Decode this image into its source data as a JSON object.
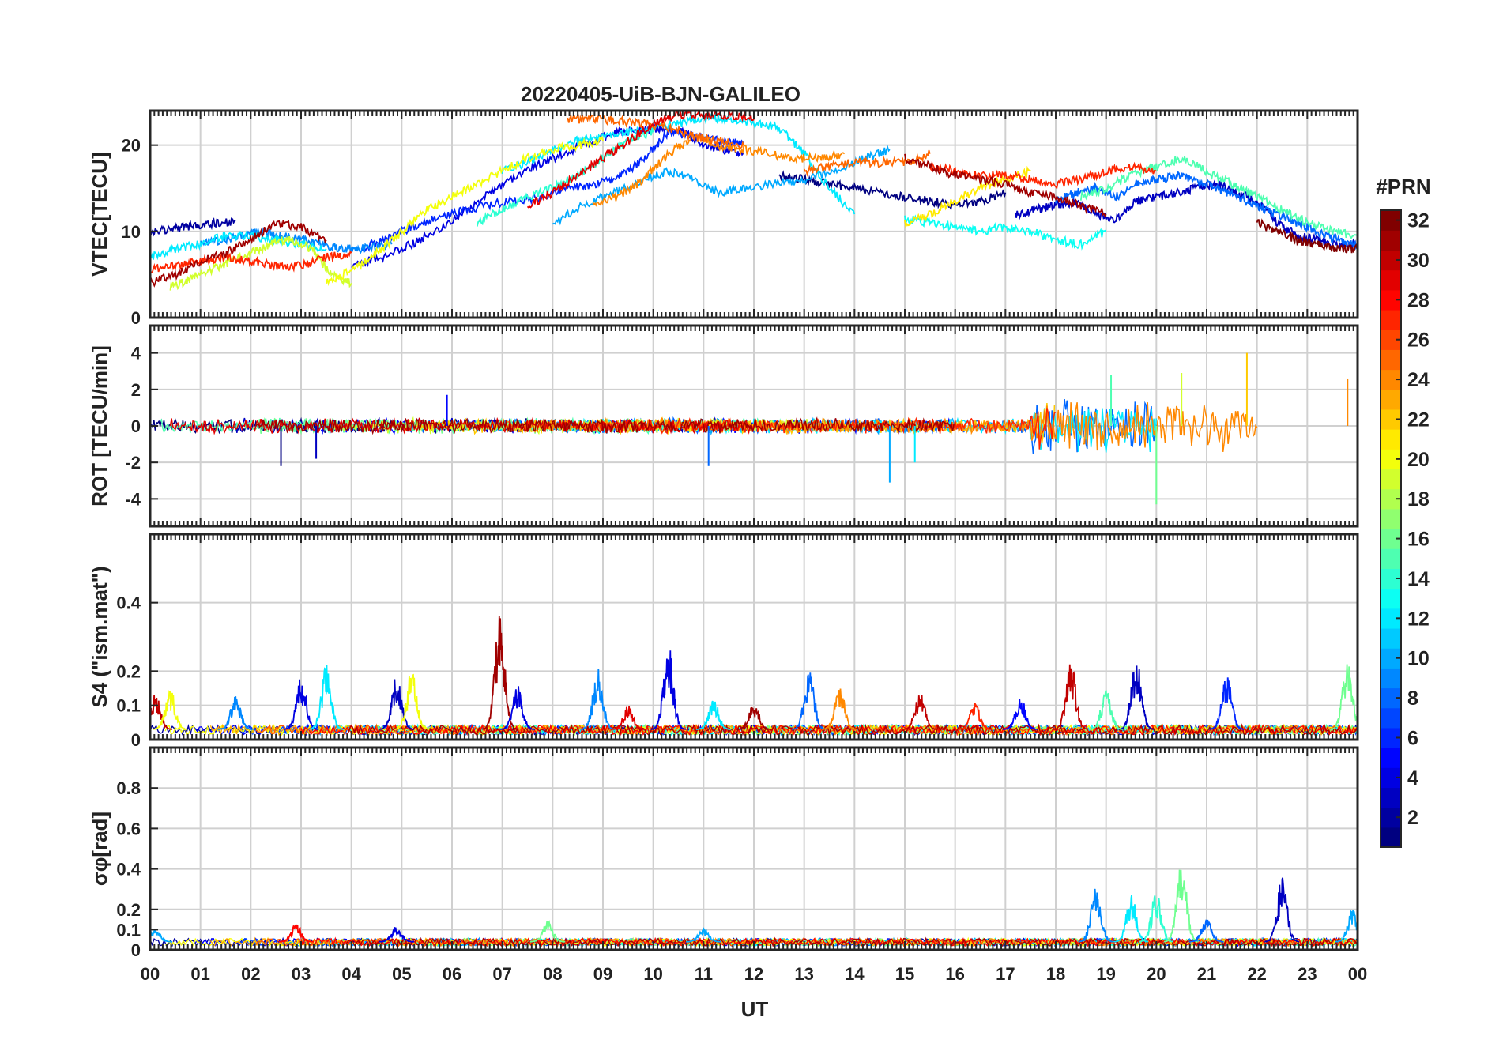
{
  "chart_data": {
    "type": "line",
    "title": "20220405-UiB-BJN-GALILEO",
    "xlabel": "UT",
    "x_tick_labels": [
      "00",
      "01",
      "02",
      "03",
      "04",
      "05",
      "06",
      "07",
      "08",
      "09",
      "10",
      "11",
      "12",
      "13",
      "14",
      "15",
      "16",
      "17",
      "18",
      "19",
      "20",
      "21",
      "22",
      "23",
      "00"
    ],
    "xlim": [
      0,
      24
    ],
    "grid": true,
    "colorbar": {
      "label": "#PRN",
      "colormap": "jet",
      "range": [
        1,
        32
      ],
      "tick_labels": [
        "2",
        "4",
        "6",
        "8",
        "10",
        "12",
        "14",
        "16",
        "18",
        "20",
        "22",
        "24",
        "26",
        "28",
        "30",
        "32"
      ]
    },
    "panels": [
      {
        "id": "vtec",
        "ylabel": "VTEC[TECU]",
        "ylim": [
          0,
          24
        ],
        "yticks": [
          0,
          10,
          20
        ],
        "series": [
          {
            "prn": 2,
            "x": [
              0.0,
              0.4,
              0.8,
              1.2,
              1.7
            ],
            "y": [
              10.0,
              10.2,
              10.6,
              10.9,
              11.2
            ]
          },
          {
            "prn": 4,
            "x": [
              4.0,
              4.6,
              5.2,
              5.8,
              6.4,
              7.0,
              7.6,
              8.2,
              8.8,
              9.3,
              9.8,
              10.2,
              10.6,
              11.0,
              11.4,
              11.8
            ],
            "y": [
              6.0,
              7.0,
              8.5,
              10.5,
              13.0,
              15.5,
              17.5,
              19.0,
              20.5,
              21.5,
              21.8,
              22.0,
              21.5,
              20.0,
              19.5,
              19.0
            ]
          },
          {
            "prn": 6,
            "x": [
              4.2,
              4.8,
              5.4,
              6.0,
              6.6,
              7.2,
              7.8,
              8.4,
              8.9,
              9.4,
              9.9,
              10.3,
              10.8,
              11.3,
              11.8
            ],
            "y": [
              8.0,
              9.5,
              11.0,
              12.0,
              13.0,
              13.5,
              14.0,
              15.0,
              15.5,
              16.5,
              19.0,
              21.5,
              21.0,
              20.5,
              20.2
            ]
          },
          {
            "prn": 1,
            "x": [
              12.5,
              13.0,
              13.5,
              14.0,
              14.5,
              15.0,
              15.5,
              16.0,
              16.5,
              17.0
            ],
            "y": [
              16.5,
              16.0,
              15.5,
              15.0,
              14.5,
              14.0,
              13.5,
              13.0,
              13.5,
              14.5
            ]
          },
          {
            "prn": 3,
            "x": [
              17.2,
              17.6,
              18.0,
              18.4,
              18.8,
              19.2,
              19.6,
              20.0,
              20.4,
              20.8,
              21.2,
              21.6,
              22.0,
              22.4,
              22.8,
              23.2,
              23.6,
              24.0
            ],
            "y": [
              12.0,
              12.5,
              13.0,
              13.5,
              12.0,
              11.5,
              13.5,
              14.0,
              14.5,
              15.0,
              15.5,
              14.5,
              13.5,
              11.0,
              9.5,
              9.0,
              8.5,
              8.5
            ]
          },
          {
            "prn": 9,
            "x": [
              1.0,
              1.4,
              1.8,
              2.2,
              2.6,
              3.0,
              3.4,
              3.8,
              4.2,
              4.8
            ],
            "y": [
              8.5,
              9.0,
              9.5,
              10.0,
              9.5,
              9.0,
              8.5,
              8.0,
              8.0,
              8.5
            ]
          },
          {
            "prn": 10,
            "x": [
              8.0,
              8.6,
              9.2,
              9.8,
              10.3,
              10.8,
              11.3,
              11.8,
              12.4,
              13.0,
              13.6,
              14.2,
              14.7
            ],
            "y": [
              11.0,
              13.0,
              14.5,
              16.0,
              17.0,
              16.0,
              14.5,
              15.0,
              15.5,
              16.0,
              17.0,
              18.5,
              19.5
            ]
          },
          {
            "prn": 8,
            "x": [
              18.0,
              18.4,
              18.8,
              19.2,
              19.6,
              20.0,
              20.4,
              20.8,
              21.2,
              21.6,
              22.0,
              22.4,
              22.8,
              23.2,
              23.6,
              24.0
            ],
            "y": [
              13.5,
              14.5,
              15.0,
              14.0,
              15.5,
              16.0,
              16.5,
              16.0,
              15.0,
              14.0,
              13.0,
              12.0,
              11.0,
              10.0,
              9.0,
              8.5
            ]
          },
          {
            "prn": 12,
            "x": [
              0.0,
              0.5,
              1.0,
              1.5,
              2.0,
              2.5,
              3.0,
              3.5
            ],
            "y": [
              7.0,
              8.0,
              8.5,
              9.5,
              9.5,
              9.0,
              8.5,
              8.0
            ]
          },
          {
            "prn": 12,
            "x": [
              7.0,
              7.5,
              8.0,
              8.5,
              9.0,
              9.5,
              10.0,
              10.5,
              11.0,
              11.5,
              12.0,
              12.5,
              13.0,
              13.5,
              14.0
            ],
            "y": [
              17.0,
              18.0,
              19.5,
              20.5,
              21.0,
              21.5,
              22.0,
              22.5,
              23.0,
              23.0,
              22.5,
              22.0,
              19.0,
              15.0,
              12.0
            ]
          },
          {
            "prn": 13,
            "x": [
              15.0,
              15.5,
              16.0,
              16.5,
              17.0,
              17.5,
              18.0,
              18.5,
              19.0
            ],
            "y": [
              11.5,
              11.0,
              10.5,
              10.0,
              10.5,
              10.0,
              9.0,
              8.5,
              10.0
            ]
          },
          {
            "prn": 15,
            "x": [
              18.5,
              19.0,
              19.5,
              20.0,
              20.5,
              21.0,
              21.5,
              22.0,
              22.5,
              23.0,
              23.5,
              24.0
            ],
            "y": [
              14.0,
              15.0,
              16.5,
              17.5,
              18.5,
              17.0,
              15.5,
              14.0,
              12.5,
              11.0,
              10.0,
              9.5
            ]
          },
          {
            "prn": 14,
            "x": [
              6.5,
              7.0,
              7.5,
              8.0,
              8.5,
              9.0,
              9.5,
              10.0
            ],
            "y": [
              11.0,
              12.5,
              14.0,
              15.0,
              16.5,
              18.5,
              20.5,
              21.5
            ]
          },
          {
            "prn": 19,
            "x": [
              0.4,
              0.8,
              1.2,
              1.6,
              2.0,
              2.4,
              2.8,
              3.2,
              3.6,
              4.0
            ],
            "y": [
              3.5,
              4.5,
              5.5,
              6.5,
              7.5,
              8.5,
              9.0,
              8.0,
              5.0,
              4.0
            ]
          },
          {
            "prn": 20,
            "x": [
              3.5,
              4.0,
              4.5,
              5.0,
              5.5,
              6.0,
              6.5,
              7.0,
              7.5,
              8.0,
              8.5,
              9.0
            ],
            "y": [
              4.0,
              5.5,
              7.5,
              10.0,
              12.5,
              14.0,
              15.5,
              17.0,
              18.5,
              19.5,
              20.0,
              20.5
            ]
          },
          {
            "prn": 21,
            "x": [
              15.0,
              15.5,
              16.0,
              16.5,
              17.0,
              17.5
            ],
            "y": [
              11.0,
              12.0,
              13.5,
              15.0,
              16.0,
              17.0
            ]
          },
          {
            "prn": 24,
            "x": [
              8.8,
              9.3,
              9.8,
              10.3,
              10.8,
              11.3,
              11.8,
              12.3,
              12.8,
              13.3,
              13.8
            ],
            "y": [
              13.0,
              14.0,
              16.0,
              19.0,
              21.0,
              20.0,
              19.5,
              19.0,
              18.5,
              18.5,
              19.0
            ]
          },
          {
            "prn": 25,
            "x": [
              8.3,
              8.8,
              9.3,
              9.8,
              10.3,
              10.8,
              11.3,
              11.8
            ],
            "y": [
              23.0,
              23.0,
              22.8,
              22.5,
              22.0,
              21.0,
              20.5,
              20.0
            ]
          },
          {
            "prn": 25,
            "x": [
              13.0,
              13.5,
              14.0,
              14.5,
              15.0,
              15.5
            ],
            "y": [
              17.0,
              17.5,
              18.0,
              18.0,
              18.0,
              19.0
            ]
          },
          {
            "prn": 27,
            "x": [
              0.0,
              0.5,
              1.0,
              1.5,
              2.0,
              2.5,
              3.0,
              3.5,
              4.0
            ],
            "y": [
              5.5,
              6.0,
              6.5,
              7.0,
              6.5,
              6.0,
              6.0,
              7.0,
              7.5
            ]
          },
          {
            "prn": 27,
            "x": [
              15.5,
              16.0,
              16.5,
              17.0,
              17.5,
              18.0,
              18.5,
              19.0,
              19.5,
              20.0
            ],
            "y": [
              17.5,
              17.0,
              16.5,
              16.5,
              16.0,
              15.5,
              16.0,
              17.0,
              17.5,
              17.0
            ]
          },
          {
            "prn": 29,
            "x": [
              7.5,
              8.0,
              8.5,
              9.0,
              9.5,
              10.0,
              10.5,
              11.0,
              11.5,
              12.0
            ],
            "y": [
              13.0,
              14.5,
              16.5,
              18.5,
              20.5,
              22.5,
              23.5,
              23.5,
              23.5,
              23.0
            ]
          },
          {
            "prn": 31,
            "x": [
              0.0,
              0.5,
              1.0,
              1.5,
              2.0,
              2.5,
              3.0,
              3.5
            ],
            "y": [
              4.0,
              5.0,
              6.5,
              7.5,
              9.0,
              11.0,
              10.5,
              9.0
            ]
          },
          {
            "prn": 31,
            "x": [
              15.0,
              15.5,
              16.0,
              16.5,
              17.0,
              17.5,
              18.0,
              18.5,
              19.0
            ],
            "y": [
              18.5,
              17.5,
              16.5,
              16.0,
              15.5,
              14.5,
              14.0,
              13.0,
              12.0
            ]
          },
          {
            "prn": 32,
            "x": [
              22.0,
              22.4,
              22.8,
              23.2,
              23.6,
              24.0
            ],
            "y": [
              11.0,
              10.0,
              9.0,
              8.5,
              8.0,
              8.0
            ]
          }
        ]
      },
      {
        "id": "rot",
        "ylabel": "ROT [TECU/min]",
        "ylim": [
          -5.5,
          5.5
        ],
        "yticks": [
          -4,
          -2,
          0,
          2,
          4
        ],
        "noise": {
          "base_amplitude": 0.45,
          "disturbed_hours": [
            [
              17.5,
              24.0
            ]
          ],
          "disturbed_amplitude": 1.6,
          "spikes": [
            [
              2.6,
              -2.2
            ],
            [
              3.3,
              -1.8
            ],
            [
              5.9,
              1.7
            ],
            [
              11.1,
              -2.2
            ],
            [
              14.7,
              -3.1
            ],
            [
              15.2,
              -2.0
            ],
            [
              19.1,
              2.8
            ],
            [
              20.0,
              -4.3
            ],
            [
              20.5,
              2.9
            ],
            [
              21.8,
              4.0
            ],
            [
              23.8,
              2.6
            ]
          ]
        },
        "prns": [
          1,
          3,
          5,
          8,
          10,
          12,
          15,
          16,
          19,
          22,
          24,
          27,
          29,
          31
        ]
      },
      {
        "id": "s4",
        "ylabel": "S4 (\"ism.mat\")",
        "ylim": [
          0,
          0.6
        ],
        "yticks": [
          0,
          0.1,
          0.2,
          0.4
        ],
        "baseline": 0.03,
        "bursts": [
          {
            "hour": 0.1,
            "peak": 0.14,
            "prn": 30
          },
          {
            "hour": 0.4,
            "peak": 0.15,
            "prn": 20
          },
          {
            "hour": 1.7,
            "peak": 0.13,
            "prn": 9
          },
          {
            "hour": 3.0,
            "peak": 0.19,
            "prn": 4
          },
          {
            "hour": 3.5,
            "peak": 0.22,
            "prn": 12
          },
          {
            "hour": 4.9,
            "peak": 0.19,
            "prn": 3
          },
          {
            "hour": 5.2,
            "peak": 0.21,
            "prn": 20
          },
          {
            "hour": 6.95,
            "peak": 0.37,
            "prn": 31
          },
          {
            "hour": 7.3,
            "peak": 0.16,
            "prn": 4
          },
          {
            "hour": 8.9,
            "peak": 0.21,
            "prn": 9
          },
          {
            "hour": 9.5,
            "peak": 0.1,
            "prn": 29
          },
          {
            "hour": 10.3,
            "peak": 0.28,
            "prn": 4
          },
          {
            "hour": 11.2,
            "peak": 0.12,
            "prn": 12
          },
          {
            "hour": 12.0,
            "peak": 0.11,
            "prn": 31
          },
          {
            "hour": 13.1,
            "peak": 0.21,
            "prn": 8
          },
          {
            "hour": 13.7,
            "peak": 0.16,
            "prn": 24
          },
          {
            "hour": 15.3,
            "peak": 0.14,
            "prn": 30
          },
          {
            "hour": 16.4,
            "peak": 0.11,
            "prn": 27
          },
          {
            "hour": 17.3,
            "peak": 0.13,
            "prn": 5
          },
          {
            "hour": 18.3,
            "peak": 0.23,
            "prn": 30
          },
          {
            "hour": 19.6,
            "peak": 0.25,
            "prn": 3
          },
          {
            "hour": 19.0,
            "peak": 0.15,
            "prn": 15
          },
          {
            "hour": 21.4,
            "peak": 0.2,
            "prn": 6
          },
          {
            "hour": 23.8,
            "peak": 0.24,
            "prn": 16
          }
        ]
      },
      {
        "id": "sigma_phi",
        "ylabel": "σφ[rad]",
        "ylim": [
          0,
          1.0
        ],
        "yticks": [
          0,
          0.1,
          0.2,
          0.4,
          0.6,
          0.8
        ],
        "baseline": 0.04,
        "bursts": [
          {
            "hour": 0.1,
            "peak": 0.1,
            "prn": 10
          },
          {
            "hour": 2.9,
            "peak": 0.13,
            "prn": 28
          },
          {
            "hour": 4.9,
            "peak": 0.12,
            "prn": 4
          },
          {
            "hour": 7.9,
            "peak": 0.15,
            "prn": 16
          },
          {
            "hour": 11.0,
            "peak": 0.11,
            "prn": 10
          },
          {
            "hour": 18.8,
            "peak": 0.32,
            "prn": 9
          },
          {
            "hour": 19.5,
            "peak": 0.28,
            "prn": 12
          },
          {
            "hour": 20.0,
            "peak": 0.3,
            "prn": 14
          },
          {
            "hour": 20.5,
            "peak": 0.47,
            "prn": 16
          },
          {
            "hour": 21.0,
            "peak": 0.16,
            "prn": 8
          },
          {
            "hour": 22.5,
            "peak": 0.36,
            "prn": 3
          },
          {
            "hour": 23.9,
            "peak": 0.2,
            "prn": 10
          }
        ]
      }
    ]
  }
}
